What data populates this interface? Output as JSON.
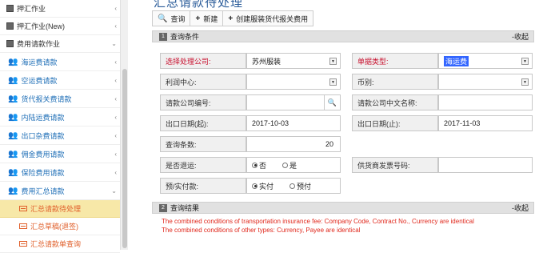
{
  "sidebar": {
    "top_items": [
      {
        "label": "押汇作业",
        "arrow": "‹"
      },
      {
        "label": "押汇作业(New)",
        "arrow": "‹"
      },
      {
        "label": "费用请款作业",
        "arrow": "⌄"
      }
    ],
    "sub_items": [
      {
        "label": "海运费请款",
        "arrow": "‹"
      },
      {
        "label": "空运费请款",
        "arrow": "‹"
      },
      {
        "label": "货代报关费请款",
        "arrow": "‹"
      },
      {
        "label": "内陆运费请款",
        "arrow": "‹"
      },
      {
        "label": "出口杂费请款",
        "arrow": "‹"
      },
      {
        "label": "佣金费用请款",
        "arrow": "‹"
      },
      {
        "label": "保险费用请款",
        "arrow": "‹"
      },
      {
        "label": "费用汇总请款",
        "arrow": "⌄"
      }
    ],
    "leaf_items": [
      {
        "label": "汇总请款待处理"
      },
      {
        "label": "汇总草稿(退签)"
      },
      {
        "label": "汇总请款单查询"
      }
    ]
  },
  "page": {
    "title": "汇总请款待处理"
  },
  "toolbar": {
    "query_label": "查询",
    "new_label": "新建",
    "create_label": "创建服装货代报关费用"
  },
  "query_section": {
    "num": "1",
    "title": "查询条件",
    "collapse": "-收起"
  },
  "form": {
    "company_label": "选择处理公司:",
    "company_value": "苏州服装",
    "doc_type_label": "单据类型:",
    "doc_type_value": "海运费",
    "profit_center_label": "利润中心:",
    "profit_center_value": "",
    "currency_label": "币别:",
    "currency_value": "",
    "company_code_label": "请款公司编号:",
    "company_code_value": "",
    "company_cn_label": "请款公司中文名称:",
    "company_cn_value": "",
    "date_from_label": "出口日期(起):",
    "date_from_value": "2017-10-03",
    "date_to_label": "出口日期(止):",
    "date_to_value": "2017-11-03",
    "count_label": "查询条数:",
    "count_value": "20",
    "returned_label": "是否退运:",
    "returned_no": "否",
    "returned_yes": "是",
    "supplier_invoice_label": "供货商发票号码:",
    "supplier_invoice_value": "",
    "prepay_label": "预/实付款:",
    "prepay_actual": "实付",
    "prepay_pre": "预付"
  },
  "result_section": {
    "num": "2",
    "title": "查询结果",
    "collapse": "-收起"
  },
  "results": {
    "msg1": "The combined conditions of transportation insurance fee: Company Code, Contract No., Currency are identical",
    "msg2": "The combined conditions of other types: Currency, Payee are identical"
  },
  "colors": {
    "accent": "#2c5d9a",
    "active_bg": "#f7e8a8",
    "required": "#c8102e",
    "error": "#e0281c"
  }
}
